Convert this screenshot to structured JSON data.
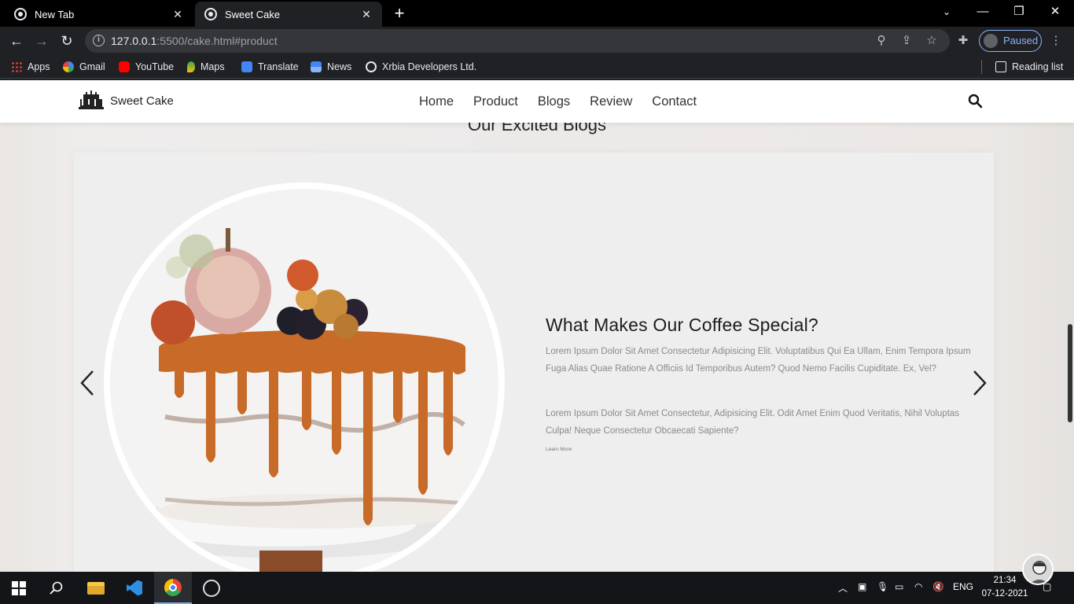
{
  "browser": {
    "tabs": [
      {
        "label": "New Tab"
      },
      {
        "label": "Sweet Cake"
      }
    ],
    "new_tab_label": "+",
    "url_host": "127.0.0.1",
    "url_rest": ":5500/cake.html#product",
    "profile_status": "Paused",
    "bookmarks": [
      {
        "label": "Apps",
        "icon": "apps-grid-icon"
      },
      {
        "label": "Gmail",
        "icon": "google-icon"
      },
      {
        "label": "YouTube",
        "icon": "youtube-icon"
      },
      {
        "label": "Maps",
        "icon": "maps-icon"
      },
      {
        "label": "Translate",
        "icon": "translate-icon"
      },
      {
        "label": "News",
        "icon": "news-icon"
      },
      {
        "label": "Xrbia Developers Ltd.",
        "icon": "globe-icon"
      }
    ],
    "reading_list": "Reading list"
  },
  "site": {
    "brand": "Sweet Cake",
    "menu": [
      "Home",
      "Product",
      "Blogs",
      "Review",
      "Contact"
    ],
    "section_title": "Our Excited Blogs",
    "blog": {
      "title": "What Makes Our Coffee Special?",
      "paragraph1": "Lorem Ipsum Dolor Sit Amet Consectetur Adipisicing Elit. Voluptatibus Qui Ea Ullam, Enim Tempora Ipsum Fuga Alias Quae Ratione A Officiis Id Temporibus Autem? Quod Nemo Facilis Cupiditate. Ex, Vel?",
      "paragraph2": "Lorem Ipsum Dolor Sit Amet Consectetur, Adipisicing Elit. Odit Amet Enim Quod Veritatis, Nihil Voluptas Culpa! Neque Consectetur Obcaecati Sapiente?",
      "learn_more": "Learn More"
    }
  },
  "taskbar": {
    "language": "ENG",
    "time": "21:34",
    "date": "07-12-2021"
  },
  "colors": {
    "chrome_dark": "#202124",
    "tabstrip": "#000000",
    "card_bg": "#eeeeee",
    "caramel": "#c86a28"
  }
}
